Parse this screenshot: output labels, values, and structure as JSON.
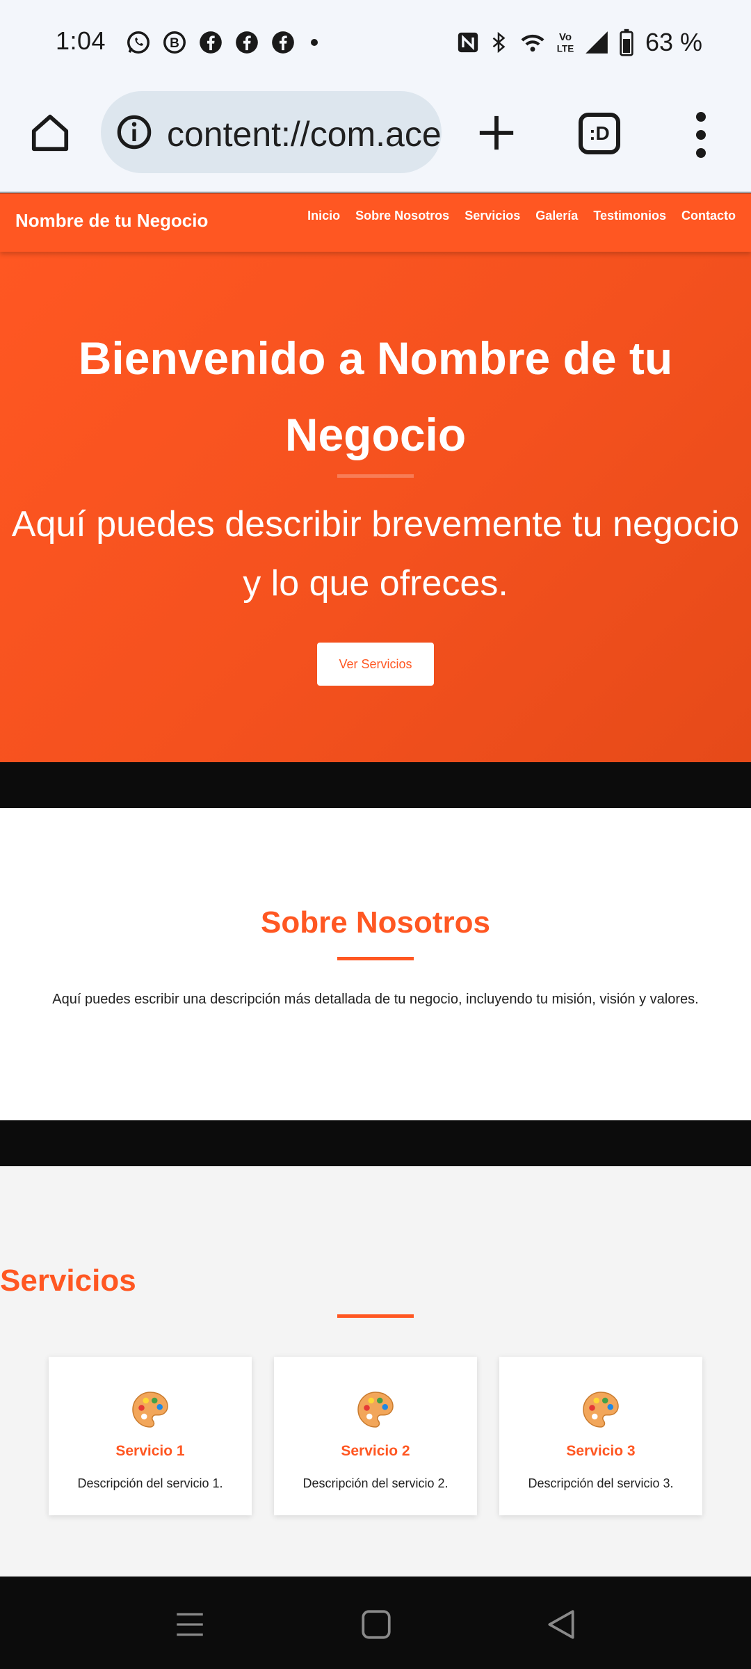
{
  "status_bar": {
    "time": "1:04",
    "battery_percent": "63 %",
    "notification_icons": [
      "whatsapp-icon",
      "whatsapp-business-icon",
      "facebook-icon",
      "facebook-icon",
      "facebook-icon",
      "more-dot-icon"
    ],
    "system_icons": [
      "nfc-icon",
      "bluetooth-icon",
      "wifi-icon",
      "volte-icon",
      "signal-icon",
      "battery-icon"
    ]
  },
  "browser": {
    "url": "content://com.ace",
    "tab_button_label": ":D",
    "icons": [
      "home-icon",
      "site-info-icon",
      "new-tab-plus-icon",
      "tab-switcher-icon",
      "overflow-menu-icon"
    ]
  },
  "site": {
    "brand": "Nombre de tu Negocio",
    "nav": [
      "Inicio",
      "Sobre Nosotros",
      "Servicios",
      "Galería",
      "Testimonios",
      "Contacto"
    ],
    "hero": {
      "title": "Bienvenido a Nombre de tu Negocio",
      "subtitle": "Aquí puedes describir brevemente tu negocio y lo que ofreces.",
      "button": "Ver Servicios"
    },
    "about": {
      "title": "Sobre Nosotros",
      "text": "Aquí puedes escribir una descripción más detallada de tu negocio, incluyendo tu misión, visión y valores."
    },
    "services": {
      "title": "Servicios",
      "items": [
        {
          "icon": "palette-icon",
          "title": "Servicio 1",
          "desc": "Descripción del servicio 1."
        },
        {
          "icon": "palette-icon",
          "title": "Servicio 2",
          "desc": "Descripción del servicio 2."
        },
        {
          "icon": "palette-icon",
          "title": "Servicio 3",
          "desc": "Descripción del servicio 3."
        }
      ]
    }
  },
  "colors": {
    "accent": "#ff5722",
    "status_bg": "#f3f6fb",
    "url_bar_bg": "#dde6ee",
    "section_alt_bg": "#f4f4f4"
  },
  "nav_bar_icons": [
    "recents-icon",
    "home-square-icon",
    "back-triangle-icon"
  ]
}
